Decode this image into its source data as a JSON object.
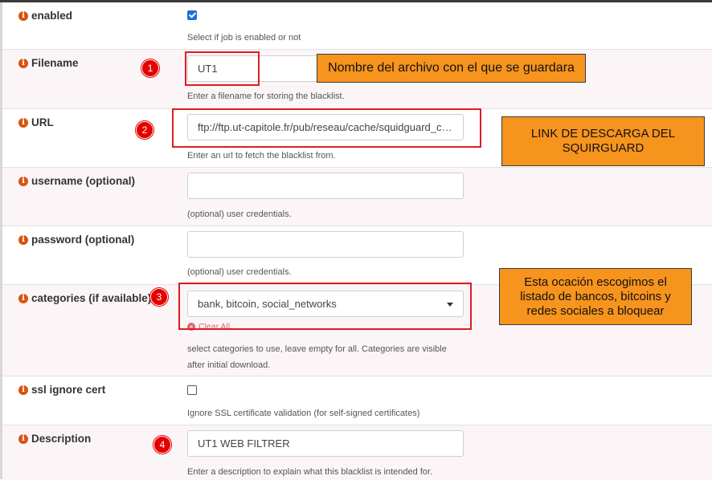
{
  "fields": {
    "enabled": {
      "label": "enabled",
      "checked": true,
      "hint": "Select if job is enabled or not"
    },
    "filename": {
      "label": "Filename",
      "value": "UT1",
      "hint": "Enter a filename for storing the blacklist."
    },
    "url": {
      "label": "URL",
      "value": "ftp://ftp.ut-capitole.fr/pub/reseau/cache/squidguard_contrib/blacklists.tar.gz",
      "hint": "Enter an url to fetch the blacklist from."
    },
    "username": {
      "label": "username (optional)",
      "value": "",
      "hint": "(optional) user credentials."
    },
    "password": {
      "label": "password (optional)",
      "value": "",
      "hint": "(optional) user credentials."
    },
    "categories": {
      "label": "categories (if available)",
      "value": "bank, bitcoin, social_networks",
      "clear_label": "Clear All",
      "hint_line1": "select categories to use, leave empty for all. Categories are visible",
      "hint_line2": "after initial download."
    },
    "ssl_ignore_cert": {
      "label": "ssl ignore cert",
      "checked": false,
      "hint": "Ignore SSL certificate validation (for self-signed certificates)"
    },
    "description": {
      "label": "Description",
      "value": "UT1 WEB FILTRER",
      "hint": "Enter a description to explain what this blacklist is intended for."
    }
  },
  "annotations": {
    "badges": [
      "1",
      "2",
      "3",
      "4"
    ],
    "note_filename": "Nombre del archivo con el que se guardara",
    "note_url_line1": "LINK DE DESCARGA DEL",
    "note_url_line2": "SQUIRGUARD",
    "note_categories_line1": "Esta ocación escogimos el",
    "note_categories_line2": "listado de bancos, bitcoins y",
    "note_categories_line3": "redes sociales a bloquear",
    "note_color": "#f7941d",
    "badge_color": "#e30000",
    "highlight_color": "#e01b24"
  },
  "icons": {
    "field_info": "info-icon",
    "clear": "clear-x-icon",
    "dropdown": "chevron-down-icon"
  }
}
